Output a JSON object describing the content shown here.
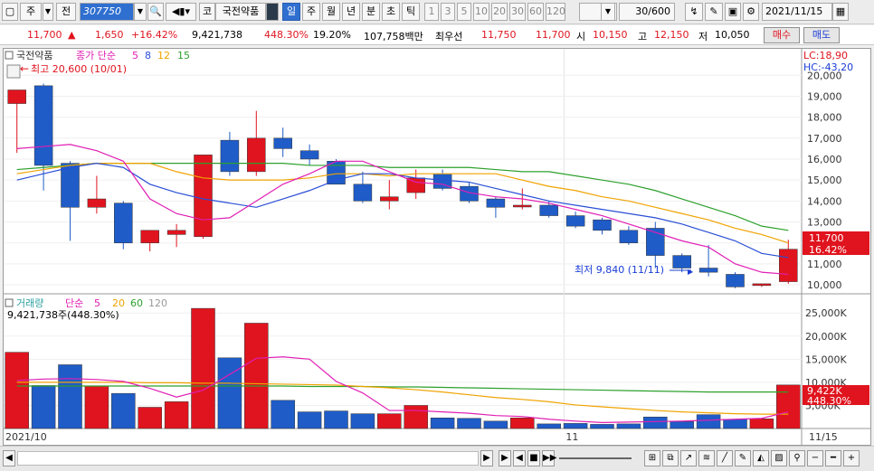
{
  "toolbar": {
    "type_label": "주",
    "jeon_label": "전",
    "code": "307750",
    "market_label": "코",
    "stock_name": "국전약품",
    "periods": [
      "일",
      "주",
      "월",
      "년",
      "분",
      "초",
      "틱"
    ],
    "selected_period": "일",
    "intervals": [
      "1",
      "3",
      "5",
      "10",
      "20",
      "30",
      "60",
      "120"
    ],
    "count_value": "30/600",
    "date_value": "2021/11/15"
  },
  "quote": {
    "price": "11,700",
    "arrow": "▲",
    "change": "1,650",
    "change_pct": "+16.42%",
    "volume": "9,421,738",
    "volume_ratio": "448.30%",
    "turnover": "19.20%",
    "amount": "107,758백만",
    "best_label": "최우선",
    "best_ask": "11,750",
    "best_bid": "11,700",
    "open_label": "시",
    "open": "10,150",
    "high_label": "고",
    "high": "12,150",
    "low_label": "저",
    "low": "10,050",
    "buy_label": "매수",
    "sell_label": "매도"
  },
  "price_panel": {
    "name": "국전약품",
    "ma_label": "종가 단순",
    "ma_periods": [
      "5",
      "8",
      "12",
      "15"
    ],
    "ma_colors": [
      "#e01eb4",
      "#2a4fd6",
      "#f0a300",
      "#2ca02c"
    ],
    "high_annotation": "최고 20,600 (10/01)",
    "low_annotation": "최저 9,840 (11/11)",
    "lc_label": "LC:18,90",
    "hc_label": "HC:-43,20",
    "current_price_tag": "11,700",
    "current_pct_tag": "16.42%",
    "y_ticks": [
      "20,000",
      "19,000",
      "18,000",
      "17,000",
      "16,000",
      "15,000",
      "14,000",
      "13,000",
      "12,000",
      "11,000",
      "10,000"
    ]
  },
  "volume_panel": {
    "label": "거래량",
    "ma_label": "단순",
    "ma_periods": [
      "5",
      "20",
      "60",
      "120"
    ],
    "ma_colors": [
      "#e01eb4",
      "#f0a300",
      "#2ca02c",
      "#999999"
    ],
    "value_text": "9,421,738주(448.30%)",
    "current_tag": "9,422K",
    "current_pct_tag": "448.30%",
    "y_ticks": [
      "25,000K",
      "20,000K",
      "15,000K",
      "10,000K",
      "5,000K"
    ]
  },
  "x_axis": {
    "labels": [
      "2021/10",
      "11",
      "11/15"
    ]
  },
  "colors": {
    "up": "#e0141e",
    "down": "#1f5cc8",
    "accent": "#2f6fd0"
  },
  "chart_data": {
    "type": "candlestick",
    "candles": [
      {
        "o": 18650,
        "h": 19300,
        "l": 16300,
        "c": 19300,
        "v": 16500
      },
      {
        "o": 19500,
        "h": 19600,
        "l": 14500,
        "c": 15700,
        "v": 9300
      },
      {
        "o": 15800,
        "h": 15900,
        "l": 12100,
        "c": 13700,
        "v": 13800
      },
      {
        "o": 13700,
        "h": 15200,
        "l": 13400,
        "c": 14100,
        "v": 9200
      },
      {
        "o": 13900,
        "h": 14000,
        "l": 11700,
        "c": 12000,
        "v": 7600
      },
      {
        "o": 12000,
        "h": 12600,
        "l": 11600,
        "c": 12600,
        "v": 4600
      },
      {
        "o": 12400,
        "h": 12900,
        "l": 11800,
        "c": 12600,
        "v": 5800
      },
      {
        "o": 12300,
        "h": 16200,
        "l": 12200,
        "c": 16200,
        "v": 26000
      },
      {
        "o": 16900,
        "h": 17300,
        "l": 15200,
        "c": 15400,
        "v": 15300
      },
      {
        "o": 15400,
        "h": 18300,
        "l": 15200,
        "c": 17000,
        "v": 22800
      },
      {
        "o": 17000,
        "h": 17500,
        "l": 16100,
        "c": 16500,
        "v": 6100
      },
      {
        "o": 16400,
        "h": 16700,
        "l": 15700,
        "c": 16000,
        "v": 3600
      },
      {
        "o": 15900,
        "h": 16000,
        "l": 14800,
        "c": 14800,
        "v": 3800
      },
      {
        "o": 14800,
        "h": 15400,
        "l": 13900,
        "c": 14000,
        "v": 3200
      },
      {
        "o": 14000,
        "h": 15000,
        "l": 13600,
        "c": 14200,
        "v": 3200
      },
      {
        "o": 14400,
        "h": 15500,
        "l": 14100,
        "c": 15100,
        "v": 5000
      },
      {
        "o": 15300,
        "h": 15500,
        "l": 14500,
        "c": 14600,
        "v": 2300
      },
      {
        "o": 14700,
        "h": 14900,
        "l": 13900,
        "c": 14000,
        "v": 2200
      },
      {
        "o": 14100,
        "h": 14200,
        "l": 13200,
        "c": 13700,
        "v": 1600
      },
      {
        "o": 13800,
        "h": 14600,
        "l": 13600,
        "c": 13800,
        "v": 2300
      },
      {
        "o": 13800,
        "h": 14000,
        "l": 13200,
        "c": 13300,
        "v": 1000
      },
      {
        "o": 13300,
        "h": 13500,
        "l": 12700,
        "c": 12800,
        "v": 1100
      },
      {
        "o": 13100,
        "h": 13200,
        "l": 12400,
        "c": 12600,
        "v": 900
      },
      {
        "o": 12600,
        "h": 12800,
        "l": 11900,
        "c": 12000,
        "v": 1000
      },
      {
        "o": 12700,
        "h": 13000,
        "l": 10800,
        "c": 11400,
        "v": 2500
      },
      {
        "o": 11400,
        "h": 11500,
        "l": 10600,
        "c": 10800,
        "v": 1500
      },
      {
        "o": 10800,
        "h": 11900,
        "l": 10400,
        "c": 10600,
        "v": 3000
      },
      {
        "o": 10500,
        "h": 10600,
        "l": 9840,
        "c": 9900,
        "v": 2000
      },
      {
        "o": 10050,
        "h": 10050,
        "l": 9900,
        "c": 10050,
        "v": 2100
      },
      {
        "o": 10150,
        "h": 12150,
        "l": 10050,
        "c": 11700,
        "v": 9422
      }
    ],
    "ma5_price": [
      16500,
      16600,
      16700,
      16400,
      15900,
      14100,
      13400,
      13100,
      13200,
      14000,
      14800,
      15300,
      15900,
      15900,
      15400,
      14900,
      14800,
      14400,
      14200,
      14100,
      13900,
      13600,
      13300,
      12900,
      12500,
      12100,
      11800,
      11000,
      10600,
      10500
    ],
    "ma8_price": [
      15000,
      15300,
      15600,
      15800,
      15600,
      14800,
      14400,
      14100,
      13900,
      13700,
      14100,
      14500,
      15000,
      15300,
      15300,
      15100,
      15000,
      14900,
      14600,
      14300,
      14000,
      13800,
      13600,
      13400,
      13200,
      12900,
      12500,
      12100,
      11500,
      11300
    ],
    "ma12_price": [
      15300,
      15500,
      15700,
      15800,
      15800,
      15800,
      15400,
      15100,
      15000,
      15000,
      15000,
      15100,
      15300,
      15300,
      15200,
      15300,
      15300,
      15300,
      15300,
      15000,
      14700,
      14500,
      14200,
      14000,
      13700,
      13400,
      13100,
      12700,
      12400,
      12000
    ],
    "ma15_price": [
      15500,
      15600,
      15700,
      15800,
      15800,
      15800,
      15800,
      15800,
      15800,
      15800,
      15800,
      15700,
      15700,
      15700,
      15600,
      15600,
      15600,
      15600,
      15500,
      15400,
      15400,
      15200,
      15000,
      14800,
      14500,
      14100,
      13700,
      13300,
      12800,
      12600
    ],
    "ma5_vol": [
      10400,
      10700,
      10800,
      10600,
      10200,
      8700,
      6800,
      8300,
      11700,
      15200,
      15500,
      15000,
      10200,
      7700,
      3900,
      3900,
      3600,
      3300,
      2800,
      2600,
      2000,
      1600,
      1300,
      1400,
      1500,
      1600,
      1800,
      2000,
      2200,
      3600
    ],
    "ma20_vol": [
      10000,
      10000,
      10000,
      10000,
      10000,
      9900,
      9900,
      9800,
      9800,
      9700,
      9600,
      9500,
      9400,
      9100,
      8800,
      8400,
      7900,
      7300,
      6700,
      6300,
      5800,
      5100,
      4700,
      4300,
      3900,
      3600,
      3400,
      3200,
      3100,
      3100
    ],
    "ma60_vol": [
      9200,
      9200,
      9200,
      9200,
      9200,
      9200,
      9200,
      9200,
      9200,
      9200,
      9200,
      9100,
      9100,
      9100,
      9000,
      9000,
      8900,
      8800,
      8700,
      8600,
      8500,
      8400,
      8300,
      8200,
      8100,
      8000,
      7900,
      7900,
      7900,
      7900
    ],
    "y_range_price": [
      9700,
      20400
    ],
    "y_range_volume": [
      0,
      27000
    ]
  }
}
